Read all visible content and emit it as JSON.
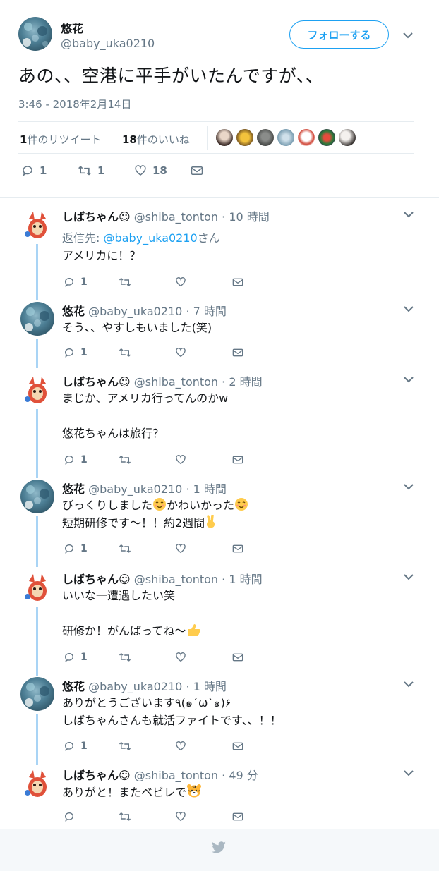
{
  "main_tweet": {
    "display_name": "悠花",
    "handle": "@baby_uka0210",
    "follow_label": "フォローする",
    "text": "あの、、空港に平手がいたんですが、、",
    "timestamp": "3:46 - 2018年2月14日",
    "retweet_count": "1",
    "retweet_label": "件のリツイート",
    "like_count": "18",
    "like_label": "件のいいね",
    "actions": {
      "reply_count": "1",
      "retweet_count": "1",
      "like_count": "18"
    }
  },
  "replies": [
    {
      "display_name": "しばちゃん☺",
      "handle": "@shiba_tonton",
      "time": "· 10 時間",
      "reply_to_prefix": "返信先: ",
      "reply_to_handle": "@baby_uka0210",
      "reply_to_suffix": "さん",
      "text": "アメリカに！？",
      "reply_count": "1"
    },
    {
      "display_name": "悠花",
      "handle": "@baby_uka0210",
      "time": "· 7 時間",
      "text": "そう、、やすしもいました(笑)",
      "reply_count": "1"
    },
    {
      "display_name": "しばちゃん☺",
      "handle": "@shiba_tonton",
      "time": "· 2 時間",
      "text": "まじか、アメリカ行ってんのかw\n\n悠花ちゃんは旅行？",
      "reply_count": "1"
    },
    {
      "display_name": "悠花",
      "handle": "@baby_uka0210",
      "time": "· 1 時間",
      "text_1": "びっくりしました",
      "text_2": "かわいかった",
      "text_3": "短期研修です〜！！約2週間",
      "reply_count": "1"
    },
    {
      "display_name": "しばちゃん☺",
      "handle": "@shiba_tonton",
      "time": "· 1 時間",
      "text_1": "いいな一遭遇したい笑\n\n研修か！がんばってね〜",
      "reply_count": "1"
    },
    {
      "display_name": "悠花",
      "handle": "@baby_uka0210",
      "time": "· 1 時間",
      "text": "ありがとうございます٩(๑´ω`๑)۶\nしばちゃんさんも就活ファイトです、、！！",
      "reply_count": "1"
    },
    {
      "display_name": "しばちゃん☺",
      "handle": "@shiba_tonton",
      "time": "· 49 分",
      "text_1": "ありがと！またベビレで",
      "reply_count": ""
    }
  ],
  "colors": {
    "accent": "#1da1f2",
    "muted": "#657786",
    "thread_line": "#a9d4f5",
    "footer_bg": "#f5f8fa"
  }
}
